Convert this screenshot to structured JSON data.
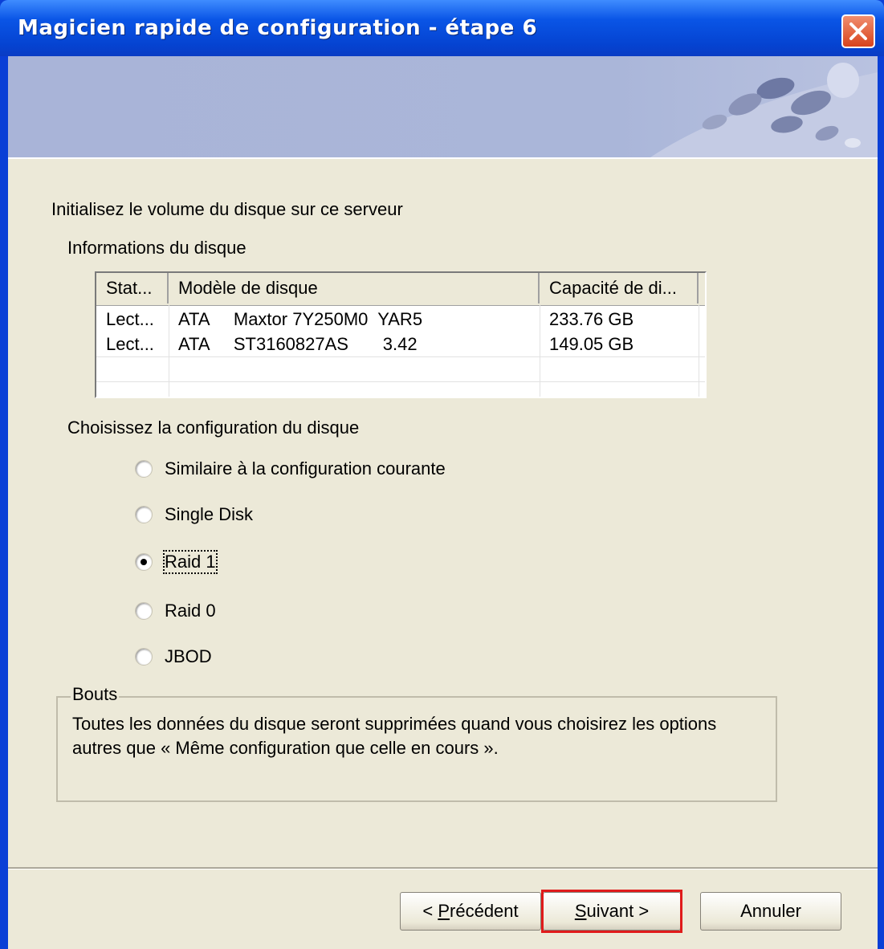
{
  "window": {
    "title": "Magicien rapide de configuration - étape 6"
  },
  "main": {
    "heading": "Initialisez le volume du disque sur ce serveur",
    "disk_info_label": "Informations du disque",
    "disk_table": {
      "columns": [
        "Stat...",
        "Modèle de disque",
        "Capacité de di..."
      ],
      "rows": [
        [
          "Lect...",
          "ATA     Maxtor 7Y250M0  YAR5",
          "233.76 GB"
        ],
        [
          "Lect...",
          "ATA     ST3160827AS       3.42",
          "149.05 GB"
        ]
      ]
    },
    "config_label": "Choisissez la configuration du disque",
    "options": [
      {
        "label": "Similaire à la configuration courante",
        "checked": false
      },
      {
        "label": "Single Disk",
        "checked": false
      },
      {
        "label": "Raid 1",
        "checked": true
      },
      {
        "label": "Raid 0",
        "checked": false
      },
      {
        "label": "JBOD",
        "checked": false
      }
    ],
    "tips": {
      "title": "Bouts",
      "line1": "Toutes les données du disque seront supprimées quand vous choisirez les options",
      "line2": "autres que « Même configuration que celle en cours »."
    }
  },
  "buttons": {
    "back_prefix": "< ",
    "back_mnemonic": "P",
    "back_rest": "récédent",
    "next_mnemonic": "S",
    "next_rest": "uivant >",
    "cancel": "Annuler"
  },
  "colors": {
    "title_bar": "#0a55e6",
    "dialog_bg": "#ece9d8",
    "banner": "#a9b4d8",
    "highlight": "#e01b1b",
    "close_button": "#d9431c"
  }
}
